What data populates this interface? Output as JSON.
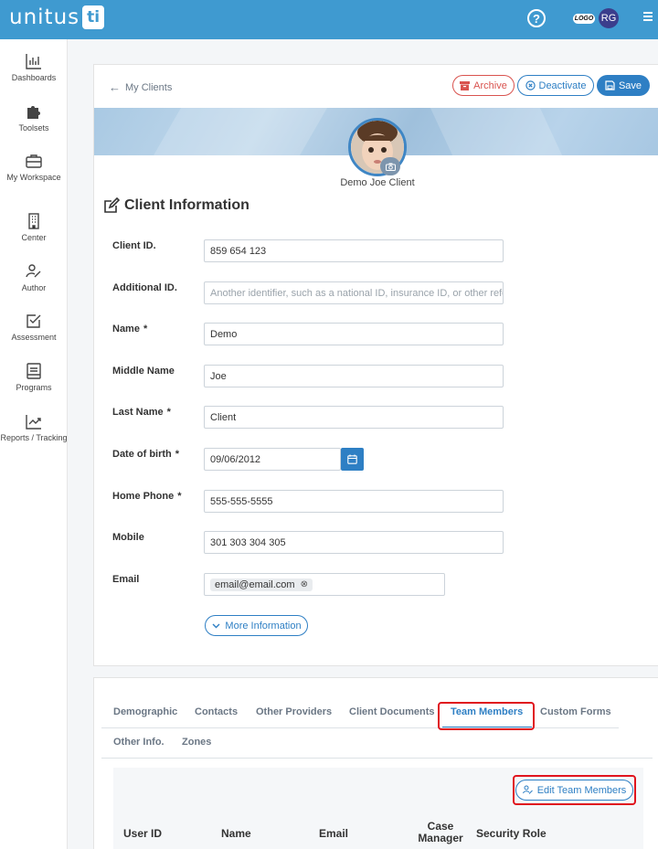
{
  "header": {
    "brand": "unitus",
    "brand_mark": "ti",
    "help_icon": "help-circle-icon",
    "org_logo": "LOGO",
    "user_initials": "RG",
    "menu_icon": "menu-icon",
    "accent": "#3f9ad0"
  },
  "sidebar": {
    "items": [
      {
        "label": "Dashboards",
        "icon": "bar-chart-icon"
      },
      {
        "label": "Toolsets",
        "icon": "puzzle-icon"
      },
      {
        "label": "My Workspace",
        "icon": "briefcase-icon"
      },
      {
        "label": "Center",
        "icon": "building-icon"
      },
      {
        "label": "Author",
        "icon": "author-pen-icon"
      },
      {
        "label": "Assessment",
        "icon": "checkbox-icon"
      },
      {
        "label": "Programs",
        "icon": "book-icon"
      },
      {
        "label": "Reports / Tracking",
        "icon": "trending-icon"
      }
    ]
  },
  "toolbar": {
    "back_label": "My Clients",
    "archive_label": "Archive",
    "deactivate_label": "Deactivate",
    "save_label": "Save"
  },
  "profile": {
    "name": "Demo Joe Client"
  },
  "client_info": {
    "title": "Client Information",
    "fields": {
      "client_id": {
        "label": "Client ID.",
        "value": "859 654 123"
      },
      "additional_id": {
        "label": "Additional ID.",
        "placeholder": "Another identifier, such as a national ID, insurance ID, or other reference"
      },
      "name": {
        "label": "Name",
        "required": "*",
        "value": "Demo"
      },
      "middle_name": {
        "label": "Middle Name",
        "value": "Joe"
      },
      "last_name": {
        "label": "Last Name",
        "required": "*",
        "value": "Client"
      },
      "dob": {
        "label": "Date of birth",
        "required": "*",
        "value": "09/06/2012"
      },
      "home_phone": {
        "label": "Home Phone",
        "required": "*",
        "value": "555-555-5555"
      },
      "mobile": {
        "label": "Mobile",
        "value": "301 303 304 305"
      },
      "email": {
        "label": "Email",
        "value": "email@email.com"
      }
    },
    "more_label": "More Information"
  },
  "tabs": {
    "items": [
      "Demographic",
      "Contacts",
      "Other Providers",
      "Client Documents",
      "Team Members",
      "Custom Forms",
      "Other Info.",
      "Zones"
    ],
    "active": "Team Members"
  },
  "team": {
    "edit_label": "Edit Team Members",
    "columns": [
      "User ID",
      "Name",
      "Email",
      "Case Manager",
      "Security Role"
    ]
  }
}
